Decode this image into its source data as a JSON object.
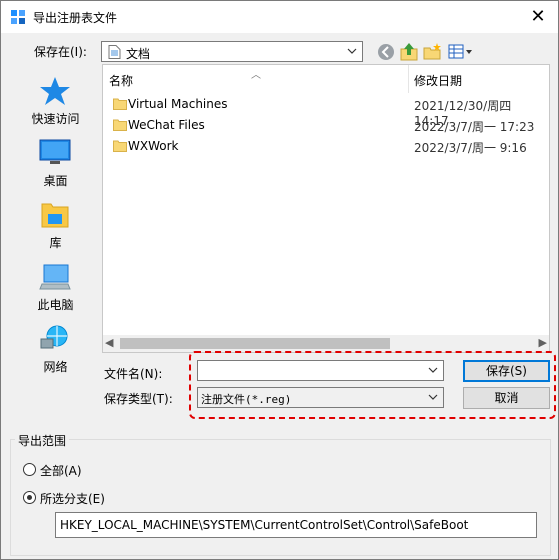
{
  "window": {
    "title": "导出注册表文件",
    "close_glyph": "✕"
  },
  "location": {
    "label": "保存在(I):",
    "value": "文档"
  },
  "places": [
    {
      "label": "快速访问",
      "icon": "star-icon"
    },
    {
      "label": "桌面",
      "icon": "desktop-icon"
    },
    {
      "label": "库",
      "icon": "library-icon"
    },
    {
      "label": "此电脑",
      "icon": "computer-icon"
    },
    {
      "label": "网络",
      "icon": "network-icon"
    }
  ],
  "file_list": {
    "columns": [
      "名称",
      "修改日期"
    ],
    "rows": [
      {
        "name": "Virtual Machines",
        "date": "2021/12/30/周四 14:17"
      },
      {
        "name": "WeChat Files",
        "date": "2022/3/7/周一 17:23"
      },
      {
        "name": "WXWork",
        "date": "2022/3/7/周一 9:16"
      }
    ]
  },
  "filename": {
    "label": "文件名(N):",
    "value": ""
  },
  "filetype": {
    "label": "保存类型(T):",
    "value": "注册文件(*.reg)"
  },
  "buttons": {
    "save": "保存(S)",
    "cancel": "取消"
  },
  "export_range": {
    "title": "导出范围",
    "option_all": "全部(A)",
    "option_branch": "所选分支(E)",
    "selected": "branch",
    "branch_path": "HKEY_LOCAL_MACHINE\\SYSTEM\\CurrentControlSet\\Control\\SafeBoot"
  },
  "colors": {
    "accent": "#0078d7",
    "highlight": "#e00000",
    "folder": "#f8d775"
  }
}
